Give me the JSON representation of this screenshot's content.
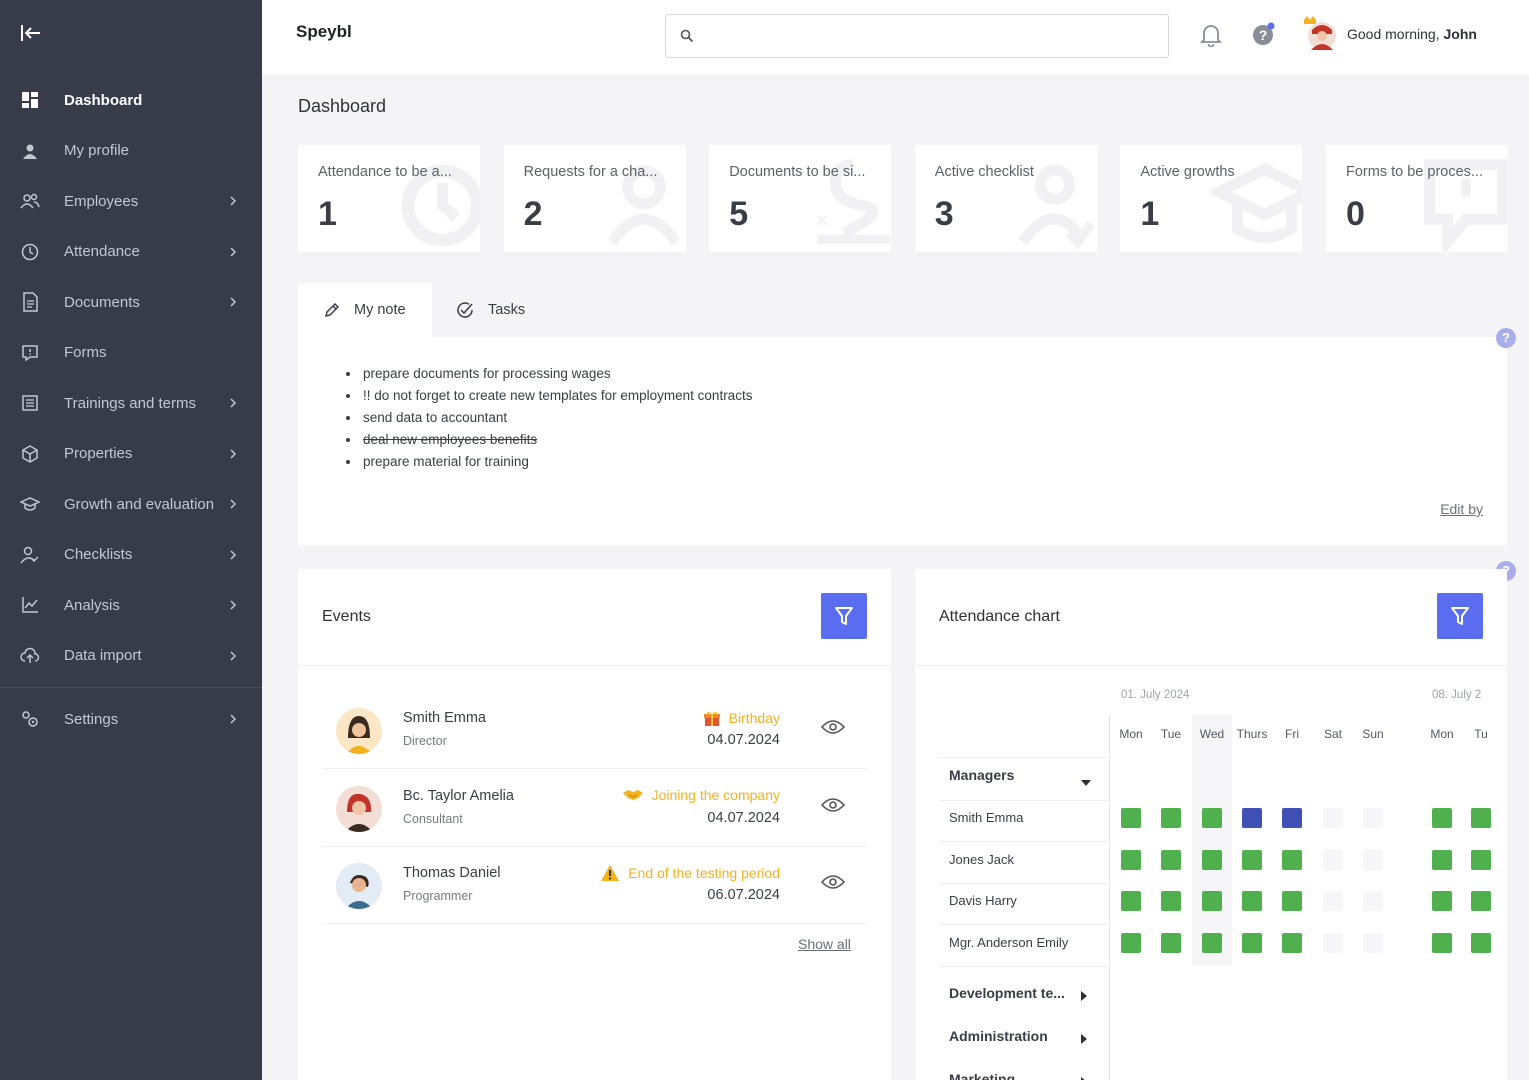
{
  "app": {
    "brand": "Speybl"
  },
  "header": {
    "search_placeholder": "",
    "greeting": "Good morning,",
    "user_name": "John"
  },
  "sidebar": {
    "items": [
      {
        "label": "Dashboard",
        "icon": "dashboard-icon",
        "active": true,
        "has_children": false
      },
      {
        "label": "My profile",
        "icon": "user-icon",
        "has_children": false
      },
      {
        "label": "Employees",
        "icon": "users-icon",
        "has_children": true
      },
      {
        "label": "Attendance",
        "icon": "clock-icon",
        "has_children": true
      },
      {
        "label": "Documents",
        "icon": "document-icon",
        "has_children": true
      },
      {
        "label": "Forms",
        "icon": "form-icon",
        "has_children": false
      },
      {
        "label": "Trainings and terms",
        "icon": "training-icon",
        "has_children": true
      },
      {
        "label": "Properties",
        "icon": "box-icon",
        "has_children": true
      },
      {
        "label": "Growth and evaluation",
        "icon": "graduation-icon",
        "has_children": true
      },
      {
        "label": "Checklists",
        "icon": "user-check-icon",
        "has_children": true
      },
      {
        "label": "Analysis",
        "icon": "chart-icon",
        "has_children": true
      },
      {
        "label": "Data import",
        "icon": "cloud-upload-icon",
        "has_children": true
      }
    ],
    "settings": {
      "label": "Settings",
      "icon": "gears-icon"
    }
  },
  "page": {
    "title": "Dashboard"
  },
  "stats": [
    {
      "label": "Attendance to be a...",
      "value": "1"
    },
    {
      "label": "Requests for a cha...",
      "value": "2"
    },
    {
      "label": "Documents to be si...",
      "value": "5"
    },
    {
      "label": "Active checklist",
      "value": "3"
    },
    {
      "label": "Active growths",
      "value": "1"
    },
    {
      "label": "Forms to be proces...",
      "value": "0"
    }
  ],
  "note": {
    "tabs": [
      {
        "label": "My note"
      },
      {
        "label": "Tasks"
      }
    ],
    "items": [
      {
        "text": "prepare documents for processing wages",
        "done": false
      },
      {
        "text": "!! do not forget to create new templates for employment contracts",
        "done": false
      },
      {
        "text": "send data to accountant",
        "done": false
      },
      {
        "text": "deal new employees benefits",
        "done": true
      },
      {
        "text": "prepare material for training",
        "done": false
      }
    ],
    "edit_label": "Edit by"
  },
  "help_mark": "?",
  "events": {
    "title": "Events",
    "show_all": "Show all",
    "items": [
      {
        "name": "Smith Emma",
        "role": "Director",
        "type": "Birthday",
        "type_icon": "gift-icon",
        "date": "04.07.2024"
      },
      {
        "name": "Bc. Taylor Amelia",
        "role": "Consultant",
        "type": "Joining the company",
        "type_icon": "handshake-icon",
        "date": "04.07.2024"
      },
      {
        "name": "Thomas Daniel",
        "role": "Programmer",
        "type": "End of the testing period",
        "type_icon": "warning-icon",
        "date": "06.07.2024"
      }
    ]
  },
  "attendance": {
    "title": "Attendance chart",
    "week1": "01. July 2024",
    "week2": "08. July 2",
    "days": [
      "Mon",
      "Tue",
      "Wed",
      "Thurs",
      "Fri",
      "Sat",
      "Sun",
      "Mon",
      "Tu"
    ],
    "groups": [
      {
        "name": "Managers",
        "expanded": true,
        "rows": [
          {
            "name": "Smith Emma",
            "cells": [
              "g",
              "g",
              "g",
              "b",
              "b",
              "e",
              "e",
              "g",
              "g"
            ]
          },
          {
            "name": "Jones Jack",
            "cells": [
              "g",
              "g",
              "g",
              "g",
              "g",
              "e",
              "e",
              "g",
              "g"
            ]
          },
          {
            "name": "Davis Harry",
            "cells": [
              "g",
              "g",
              "g",
              "g",
              "g",
              "e",
              "e",
              "g",
              "g"
            ]
          },
          {
            "name": "Mgr. Anderson Emily",
            "cells": [
              "g",
              "g",
              "g",
              "g",
              "g",
              "e",
              "e",
              "g",
              "g"
            ]
          }
        ]
      },
      {
        "name": "Development te...",
        "expanded": false
      },
      {
        "name": "Administration",
        "expanded": false
      },
      {
        "name": "Marketing",
        "expanded": false
      }
    ],
    "colors": {
      "present": "#4fb04d",
      "absent": "#3f51b5",
      "weekend": "#f7f7f9"
    }
  },
  "colors": {
    "sidebar": "#383c4a",
    "accent": "#5a6df0",
    "event_type": "#f2b21c"
  }
}
